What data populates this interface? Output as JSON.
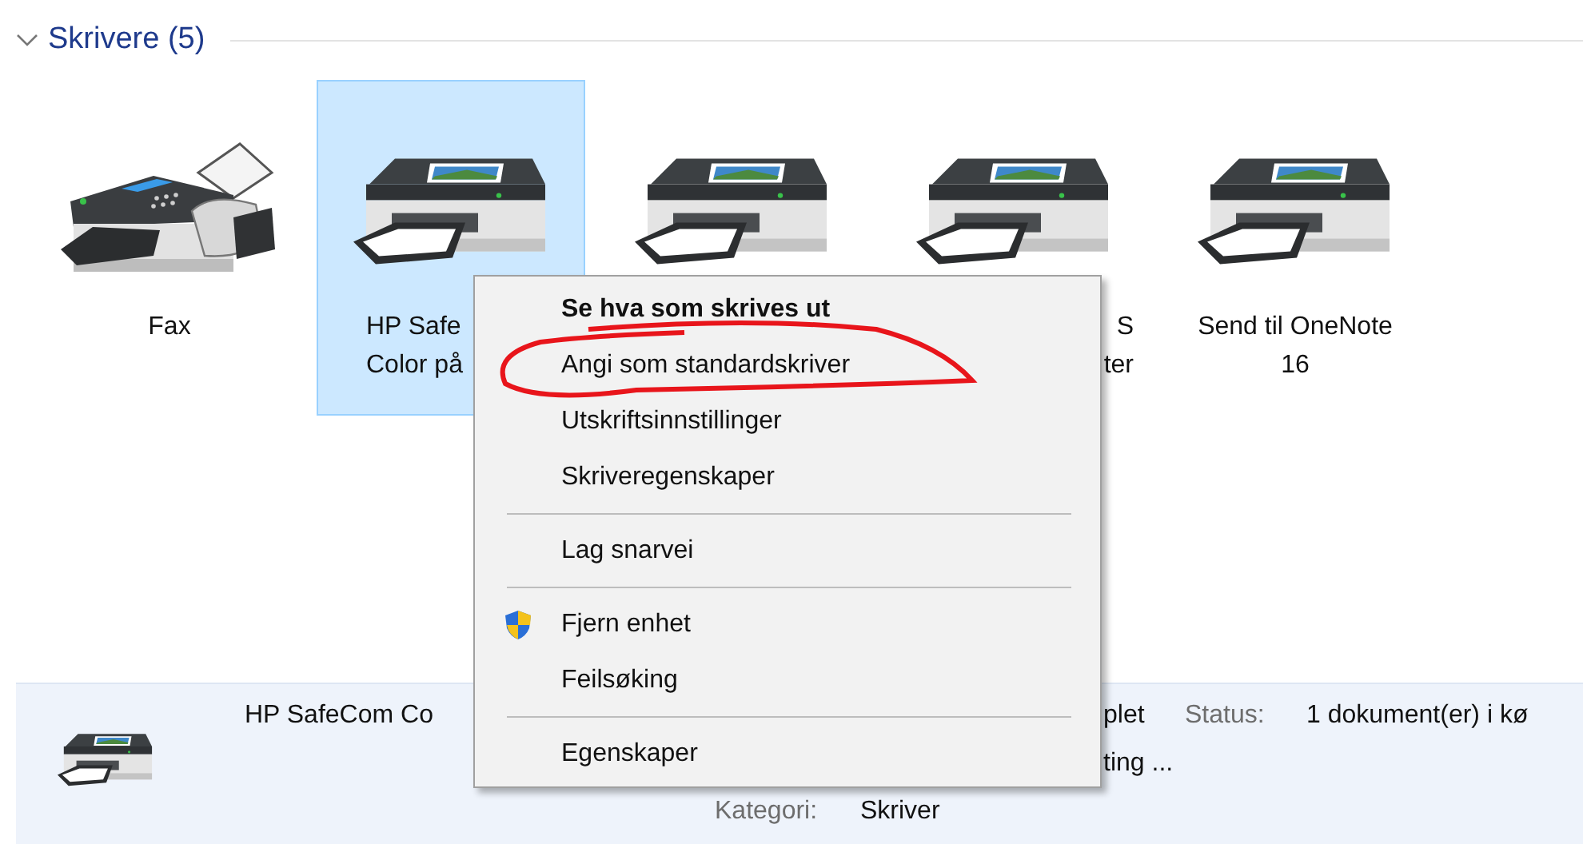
{
  "section": {
    "title": "Skrivere (5)",
    "expanded": true
  },
  "devices": [
    {
      "kind": "fax",
      "lines": [
        "Fax"
      ],
      "selected": false
    },
    {
      "kind": "printer",
      "lines": [
        "HP Safe",
        "Color på"
      ],
      "cut_end": true,
      "selected": true
    },
    {
      "kind": "printer",
      "selected": false
    },
    {
      "kind": "printer",
      "lines": [
        "S",
        "ter"
      ],
      "cut_start": true,
      "selected": false
    },
    {
      "kind": "printer",
      "lines": [
        "Send til OneNote",
        "16"
      ],
      "selected": false
    }
  ],
  "context_menu": [
    {
      "kind": "item",
      "label": "Se hva som skrives ut",
      "default": true
    },
    {
      "kind": "item",
      "label": "Angi som standardskriver",
      "default": false
    },
    {
      "kind": "item",
      "label": "Utskriftsinnstillinger",
      "default": false
    },
    {
      "kind": "item",
      "label": "Skriveregenskaper",
      "default": false
    },
    {
      "kind": "separator"
    },
    {
      "kind": "item",
      "label": "Lag snarvei",
      "default": false
    },
    {
      "kind": "separator"
    },
    {
      "kind": "item",
      "label": "Fjern enhet",
      "default": false,
      "shield": true
    },
    {
      "kind": "item",
      "label": "Feilsøking",
      "default": false
    },
    {
      "kind": "separator"
    },
    {
      "kind": "item",
      "label": "Egenskaper",
      "default": false
    }
  ],
  "details": {
    "name": "HP SafeCom Co",
    "name_tail": "plet",
    "status_label": "Status:",
    "status_value": "1 dokument(er) i kø",
    "line_2_tail": "ting ...",
    "category_label": "Kategori:",
    "category_value": "Skriver"
  }
}
